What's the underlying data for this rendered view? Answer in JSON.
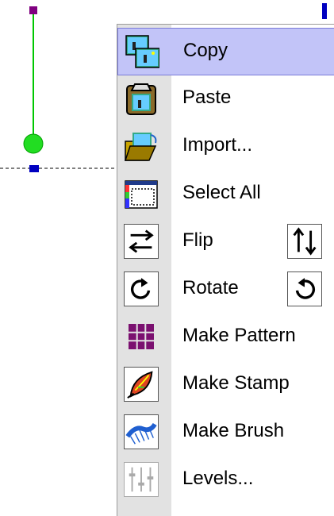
{
  "menu": {
    "items": [
      {
        "label": "Copy",
        "icon": "copy-icon",
        "selected": true
      },
      {
        "label": "Paste",
        "icon": "paste-icon"
      },
      {
        "label": "Import...",
        "icon": "import-icon"
      },
      {
        "label": "Select All",
        "icon": "select-all-icon"
      },
      {
        "label": "Flip",
        "icon": "flip-horizontal-icon",
        "secondary_icon": "flip-vertical-icon"
      },
      {
        "label": "Rotate",
        "icon": "rotate-clockwise-icon",
        "secondary_icon": "rotate-counterclockwise-icon"
      },
      {
        "label": "Make Pattern",
        "icon": "pattern-grid-icon"
      },
      {
        "label": "Make Stamp",
        "icon": "leaf-stamp-icon"
      },
      {
        "label": "Make Brush",
        "icon": "brush-icon"
      },
      {
        "label": "Levels...",
        "icon": "levels-sliders-icon"
      }
    ]
  },
  "colors": {
    "selection_bg": "#c2c4f8",
    "handle_purple": "#800080",
    "handle_green": "#00c800",
    "handle_blue": "#0000c0",
    "pattern_purple": "#7b1070"
  }
}
